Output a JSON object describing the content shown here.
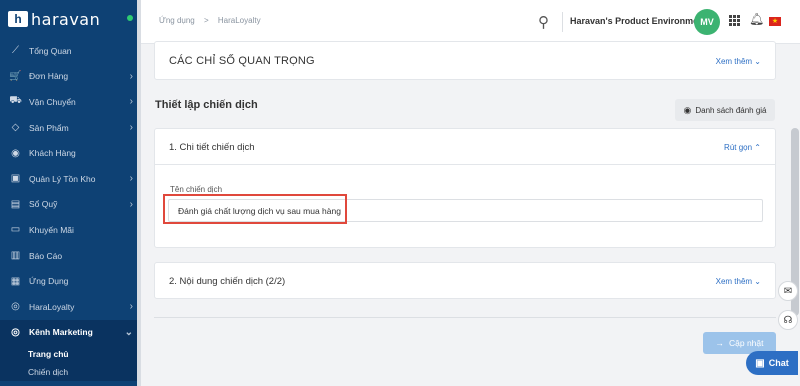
{
  "brand": {
    "logo_text": "haravan"
  },
  "sidebar": {
    "items": [
      {
        "label": "Tổng Quan",
        "icon": "trend-line-icon",
        "glyph": "⟋",
        "chevron": false
      },
      {
        "label": "Đơn Hàng",
        "icon": "cart-icon",
        "glyph": "🛒",
        "chevron": true
      },
      {
        "label": "Vận Chuyển",
        "icon": "truck-icon",
        "glyph": "⛟",
        "chevron": true
      },
      {
        "label": "Sản Phẩm",
        "icon": "tag-icon",
        "glyph": "◇",
        "chevron": true
      },
      {
        "label": "Khách Hàng",
        "icon": "user-circle-icon",
        "glyph": "◉",
        "chevron": false
      },
      {
        "label": "Quản Lý Tồn Kho",
        "icon": "inventory-icon",
        "glyph": "▣",
        "chevron": true
      },
      {
        "label": "Sổ Quỹ",
        "icon": "ledger-icon",
        "glyph": "▤",
        "chevron": true
      },
      {
        "label": "Khuyến Mãi",
        "icon": "gift-icon",
        "glyph": "▭",
        "chevron": false
      },
      {
        "label": "Báo Cáo",
        "icon": "report-icon",
        "glyph": "▥",
        "chevron": false
      },
      {
        "label": "Ứng Dụng",
        "icon": "apps-grid-icon",
        "glyph": "▦",
        "chevron": false
      },
      {
        "label": "HaraLoyalty",
        "icon": "loyalty-icon",
        "glyph": "◎",
        "chevron": true
      },
      {
        "label": "Kênh Marketing",
        "icon": "marketing-icon",
        "glyph": "◎",
        "chevron": true,
        "active": true
      }
    ],
    "sub_items": [
      "Trang chủ",
      "Chiến dịch"
    ]
  },
  "header": {
    "breadcrumb": [
      "Ứng dụng",
      ">",
      "HaraLoyalty"
    ],
    "environment": "Haravan's Product Environment",
    "avatar_initials": "MV",
    "flag_star": "★"
  },
  "main": {
    "key_metrics_title": "CÁC CHỈ SỐ QUAN TRỌNG",
    "see_more": "Xem thêm ⌄",
    "section_title": "Thiết lập chiến dịch",
    "review_list_button": "Danh sách đánh giá",
    "detail_card": {
      "title": "1. Chi tiết chiến dịch",
      "collapse": "Rút gọn ⌃",
      "field_label": "Tên chiến dịch",
      "field_value": "Đánh giá chất lượng dịch vụ sau mua hàng"
    },
    "content_card": {
      "title": "2. Nội dung chiến dịch (2/2)",
      "see_more": "Xem thêm ⌄"
    },
    "update_button": "Cập nhật"
  },
  "floating": {
    "chat_label": "Chat"
  },
  "colors": {
    "sidebar_bg": "#0e4174",
    "accent": "#2d6fc4",
    "highlight_border": "#e0483c",
    "avatar_bg": "#3cb371"
  }
}
